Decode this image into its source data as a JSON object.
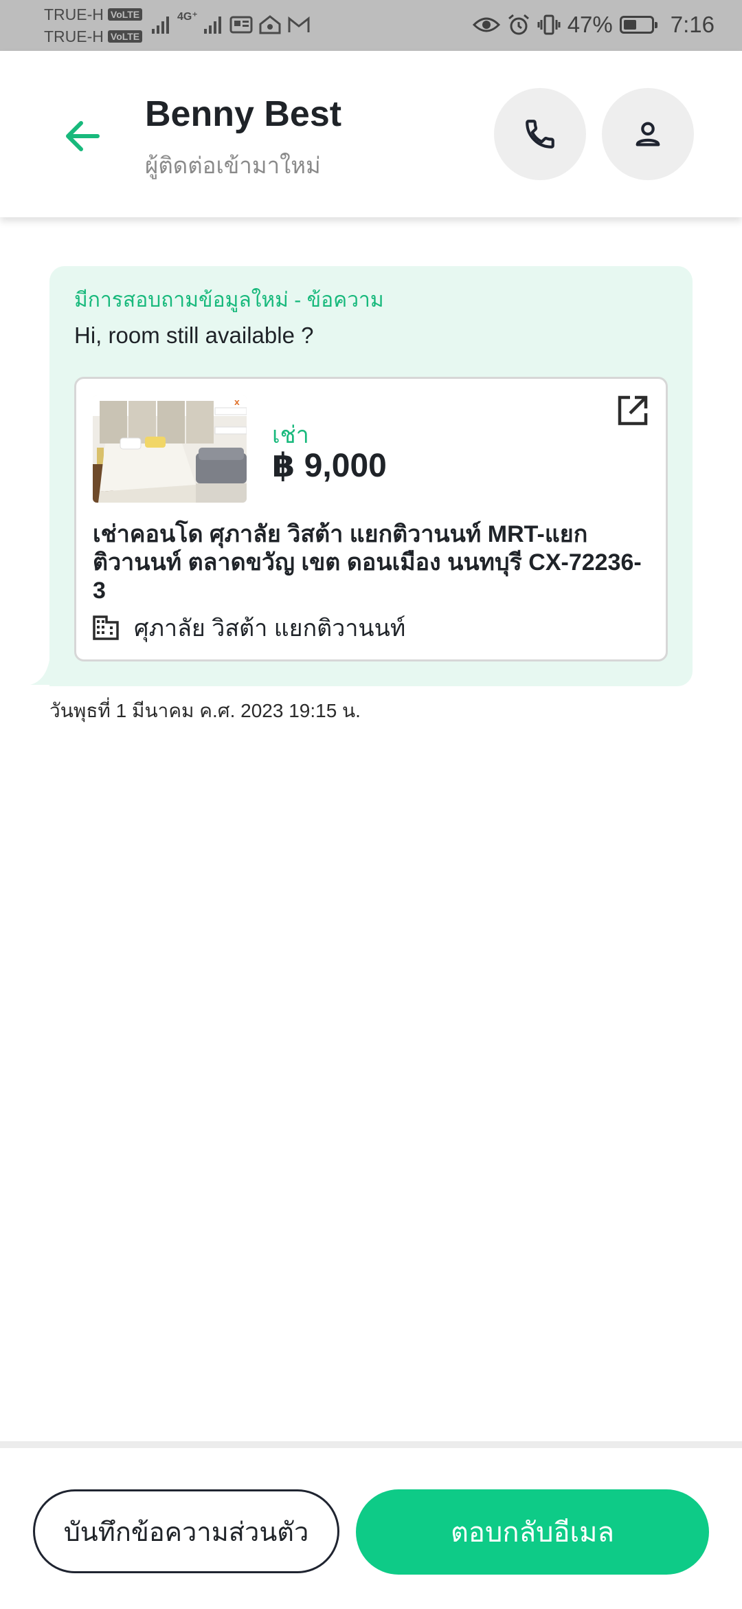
{
  "status_bar": {
    "carrier_1": "TRUE-H",
    "carrier_2": "TRUE-H",
    "volte_badge": "VoLTE",
    "network_type": "4G⁺",
    "battery_percent": "47%",
    "battery_level": 0.47,
    "time": "7:16"
  },
  "header": {
    "contact_name": "Benny Best",
    "contact_status": "ผู้ติดต่อเข้ามาใหม่",
    "accent_color": "#18b97c"
  },
  "message": {
    "inquiry_label": "มีการสอบถามข้อมูลใหม่ - ข้อความ",
    "text": "Hi, room still available ?",
    "timestamp": "วันพุธที่ 1 มีนาคม ค.ศ. 2023 19:15 น."
  },
  "listing": {
    "type": "เช่า",
    "price": "฿ 9,000",
    "title": "เช่าคอนโด  ศุภาลัย วิสต้า แยกติวานนท์ MRT-แยกติวานนท์ ตลาดขวัญ เขต ดอนเมือง นนทบุรี CX-72236-3",
    "project": "ศุภาลัย วิสต้า แยกติวานนท์"
  },
  "actions": {
    "note_label": "บันทึกข้อความส่วนตัว",
    "reply_label": "ตอบกลับอีเมล",
    "reply_color": "#0ecb87"
  },
  "icons": {
    "back": "arrow-left-icon",
    "call": "phone-icon",
    "profile": "person-icon",
    "open": "external-link-icon",
    "building": "building-icon"
  }
}
